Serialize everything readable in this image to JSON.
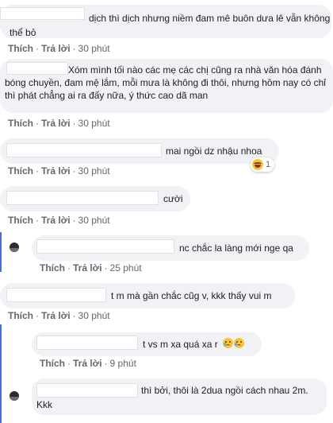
{
  "comments": [
    {
      "id": "c1",
      "text": "dịch thì dịch nhưng niềm đam mê buôn dưa lê vẫn không thể bỏ",
      "time": "30 phút"
    },
    {
      "id": "c2",
      "text": "Xóm mình tối nào các mẹ các chị cũng ra nhà văn hóa đánh bóng chuyền, đam mệ lắm, mỗi mưa là không đi thôi, nhưng hôm nay có chỉ thì phát chẳng ai ra đấy nữa, ý thức cao dã man",
      "time": "30 phút"
    },
    {
      "id": "c3",
      "text": "mai ngồi dz nhậu nhoa",
      "time": "30 phút",
      "reaction_count": "1"
    },
    {
      "id": "c4",
      "text": "cười",
      "time": "30 phút"
    },
    {
      "id": "c5",
      "text": "nc chắc la làng mới nge qa",
      "time": "25 phút"
    },
    {
      "id": "c6",
      "text": "t m mà gần chắc cũg v, kkk thấy vui m",
      "time": "30 phút"
    },
    {
      "id": "c7",
      "text": "t vs m xa quá xa r",
      "time": "9 phút"
    },
    {
      "id": "c8",
      "text_line1": "thì bởi, thôi là 2dua ngồi cách nhau 2m.",
      "text_line2": "Kkk"
    }
  ],
  "labels": {
    "like": "Thích",
    "reply": "Trả lời",
    "dot": "·"
  },
  "colors": {
    "bubble": "#f0f2f5",
    "meta": "#65676b",
    "rail": "#4b6fd6"
  },
  "icons": {
    "reaction": "laughing-emoji",
    "sad": "crying-emoji"
  }
}
